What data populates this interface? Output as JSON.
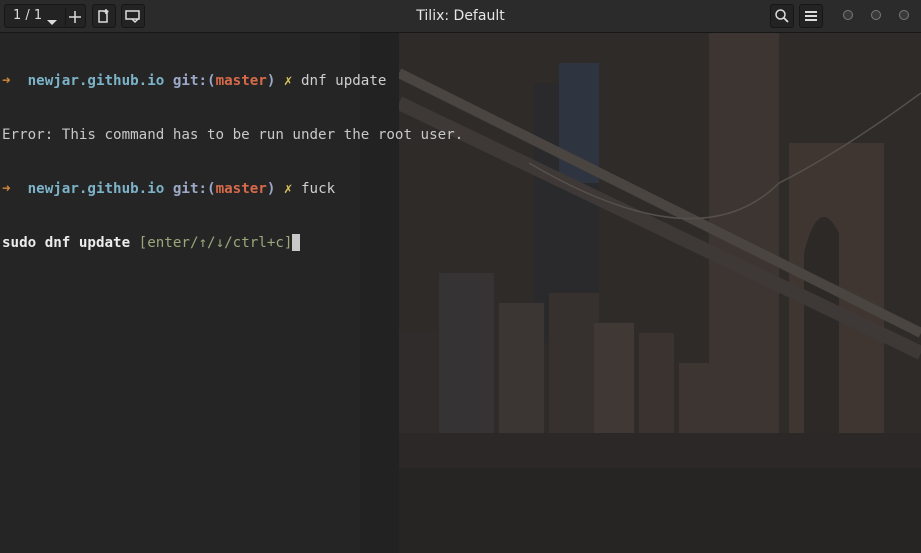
{
  "window": {
    "title": "Tilix: Default",
    "session_indicator": "1 / 1"
  },
  "icons": {
    "session_menu": "chevron-down-icon",
    "add_terminal": "plus-icon",
    "new_session": "new-session-icon",
    "sync_input": "sync-input-icon",
    "search": "search-icon",
    "menu": "hamburger-menu-icon",
    "window_controls": [
      "minimize-icon",
      "maximize-icon",
      "close-icon"
    ]
  },
  "terminal": {
    "prompt_symbol": "➜",
    "lines": [
      {
        "type": "prompt",
        "host": "newjar.github.io",
        "git_prefix": "git:(",
        "branch": "master",
        "git_suffix": ")",
        "dirty": "✗",
        "command": "dnf update"
      },
      {
        "type": "output",
        "text": "Error: This command has to be run under the root user."
      },
      {
        "type": "prompt",
        "host": "newjar.github.io",
        "git_prefix": "git:(",
        "branch": "master",
        "git_suffix": ")",
        "dirty": "✗",
        "command": "fuck"
      },
      {
        "type": "suggestion",
        "command": "sudo dnf update",
        "hint_open": "[",
        "hint_enter": "enter",
        "hint_sep1": "/",
        "hint_up": "↑",
        "hint_sep2": "/",
        "hint_down": "↓",
        "hint_sep3": "/",
        "hint_ctrl": "ctrl+c",
        "hint_close": "]"
      }
    ]
  },
  "colors": {
    "titlebar": "#2b2b2b",
    "terminal_bg": "#242424",
    "prompt_arrow": "#d4893a",
    "host": "#7cb3c8",
    "branch": "#d66a4a",
    "dirty": "#d9c25a",
    "hint": "#9aa87a"
  }
}
